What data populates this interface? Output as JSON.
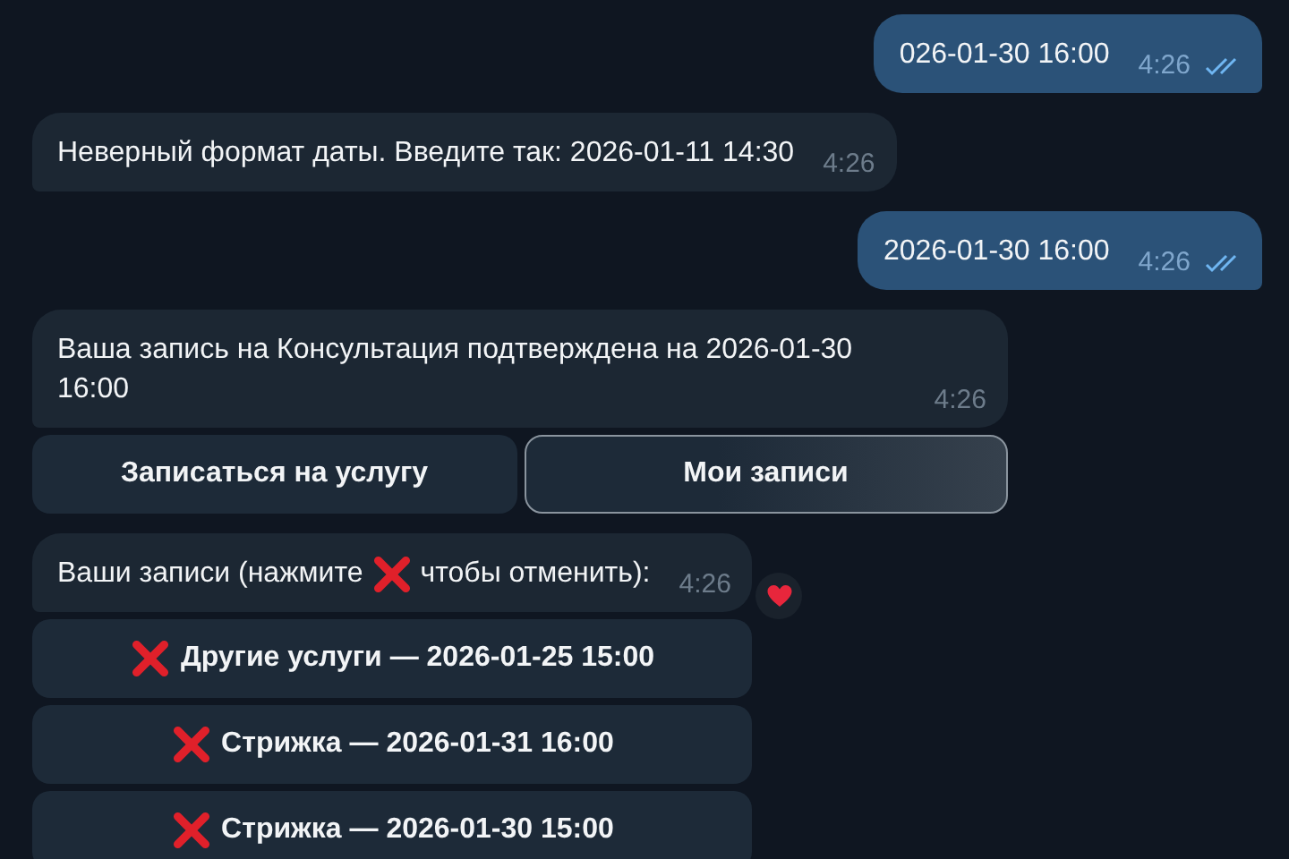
{
  "messages": [
    {
      "kind": "text",
      "outgoing": true,
      "text": "026-01-30 16:00",
      "time": "4:26",
      "read": true
    },
    {
      "kind": "text",
      "outgoing": false,
      "text": "Неверный формат даты. Введите так: 2026-01-11 14:30",
      "time": "4:26"
    },
    {
      "kind": "text",
      "outgoing": true,
      "text": "2026-01-30 16:00",
      "time": "4:26",
      "read": true
    },
    {
      "kind": "text",
      "outgoing": false,
      "text": "Ваша запись на Консультация подтверждена на 2026-01-30 16:00",
      "time": "4:26",
      "keyboard": [
        [
          {
            "label": "Записаться на услугу",
            "highlighted": false
          },
          {
            "label": "Мои записи",
            "highlighted": true
          }
        ]
      ]
    },
    {
      "kind": "cancel_list",
      "outgoing": false,
      "text_before": "Ваши записи (нажмите",
      "text_after": "чтобы отменить):",
      "time": "4:26",
      "reaction": true,
      "keyboard": [
        [
          {
            "label": "Другие услуги — 2026-01-25 15:00",
            "highlighted": false,
            "cancel_icon": true
          }
        ],
        [
          {
            "label": "Стрижка — 2026-01-31 16:00",
            "highlighted": false,
            "cancel_icon": true
          }
        ],
        [
          {
            "label": "Стрижка — 2026-01-30 15:00",
            "highlighted": false,
            "cancel_icon": true
          }
        ]
      ]
    }
  ]
}
